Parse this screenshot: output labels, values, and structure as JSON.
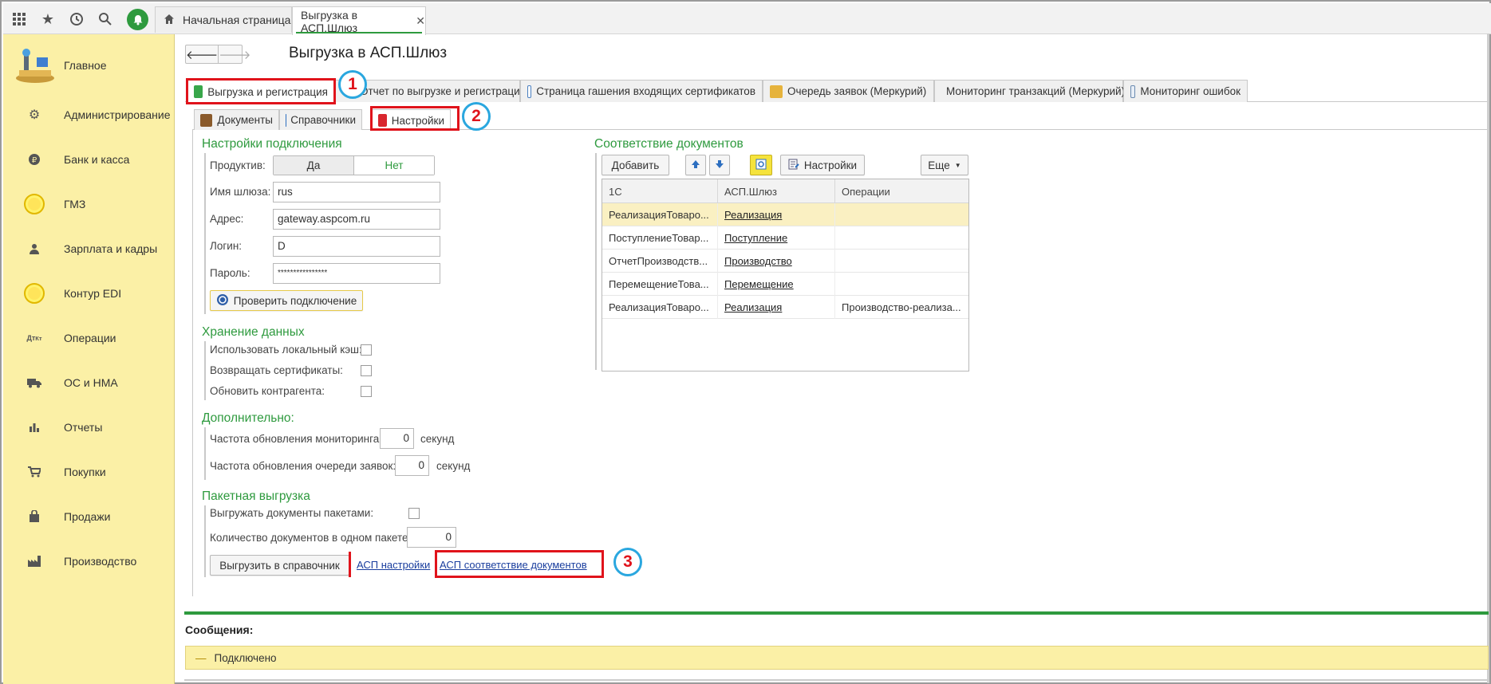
{
  "topbar": {
    "home_tab": "Начальная страница",
    "active_tab": "Выгрузка в АСП.Шлюз",
    "close_glyph": "✕"
  },
  "sidebar": {
    "items": [
      {
        "label": "Главное",
        "icon": "home-logo-icon"
      },
      {
        "label": "Администрирование",
        "icon": "gear-icon"
      },
      {
        "label": "Банк и касса",
        "icon": "ruble-coin-icon"
      },
      {
        "label": "ГМЗ",
        "icon": "yellow-circle-icon"
      },
      {
        "label": "Зарплата и кадры",
        "icon": "person-icon"
      },
      {
        "label": "Контур EDI",
        "icon": "yellow-circle-icon"
      },
      {
        "label": "Операции",
        "icon": "debit-credit-icon"
      },
      {
        "label": "ОС и НМА",
        "icon": "truck-icon"
      },
      {
        "label": "Отчеты",
        "icon": "bar-chart-icon"
      },
      {
        "label": "Покупки",
        "icon": "cart-icon"
      },
      {
        "label": "Продажи",
        "icon": "bag-icon"
      },
      {
        "label": "Производство",
        "icon": "factory-icon"
      }
    ]
  },
  "page": {
    "title": "Выгрузка в АСП.Шлюз",
    "back": "🡐",
    "forward": "🡒"
  },
  "main_tabs": [
    "Выгрузка и регистрация",
    "Отчет по выгрузке и регистрации",
    "Страница гашения входящих сертификатов",
    "Очередь заявок (Меркурий)",
    "Мониторинг транзакций (Меркурий)",
    "Мониторинг ошибок"
  ],
  "sub_tabs": [
    "Документы",
    "Справочники",
    "Настройки"
  ],
  "connection": {
    "title": "Настройки подключения",
    "productive_label": "Продуктив:",
    "yes": "Да",
    "no": "Нет",
    "gateway_label": "Имя шлюза:",
    "gateway_value": "rus",
    "address_label": "Адрес:",
    "address_value": "gateway.aspcom.ru",
    "login_label": "Логин:",
    "login_value": "D",
    "password_label": "Пароль:",
    "password_value": "****************",
    "check_button": "Проверить подключение"
  },
  "storage": {
    "title": "Хранение данных",
    "local_cache": "Использовать локальный кэш:",
    "return_certs": "Возвращать сертификаты:",
    "update_counterparty": "Обновить контрагента:"
  },
  "additional": {
    "title": "Дополнительно:",
    "monitoring_label": "Частота обновления мониторинга:",
    "monitoring_value": "0",
    "queue_label": "Частота обновления очереди заявок:",
    "queue_value": "0",
    "seconds": "секунд"
  },
  "batch": {
    "title": "Пакетная выгрузка",
    "in_batches_label": "Выгружать документы пакетами:",
    "count_label": "Количество документов в одном пакете:",
    "count_value": "0",
    "upload_button": "Выгрузить в справочник",
    "asp_settings_link": "АСП настройки",
    "asp_mapping_link": "АСП соответствие документов"
  },
  "mapping": {
    "title": "Соответствие документов",
    "add_button": "Добавить",
    "settings_button": "Настройки",
    "more_button": "Еще",
    "columns": [
      "1С",
      "АСП.Шлюз",
      "Операции"
    ],
    "rows": [
      [
        "РеализацияТоваро...",
        "Реализация",
        ""
      ],
      [
        "ПоступлениеТовар...",
        "Поступление",
        ""
      ],
      [
        "ОтчетПроизводств...",
        "Производство",
        ""
      ],
      [
        "ПеремещениеТова...",
        "Перемещение",
        ""
      ],
      [
        "РеализацияТоваро...",
        "Реализация",
        "Производство-реализа..."
      ]
    ]
  },
  "annotations": [
    "1",
    "2",
    "3"
  ],
  "messages": {
    "title": "Сообщения:",
    "text": "Подключено",
    "dash": "—"
  },
  "colors": {
    "accent_green": "#2e9a3e",
    "sidebar_yellow": "#fbf0a6",
    "highlight_red": "#e0131b",
    "badge_blue": "#2aa7df"
  }
}
